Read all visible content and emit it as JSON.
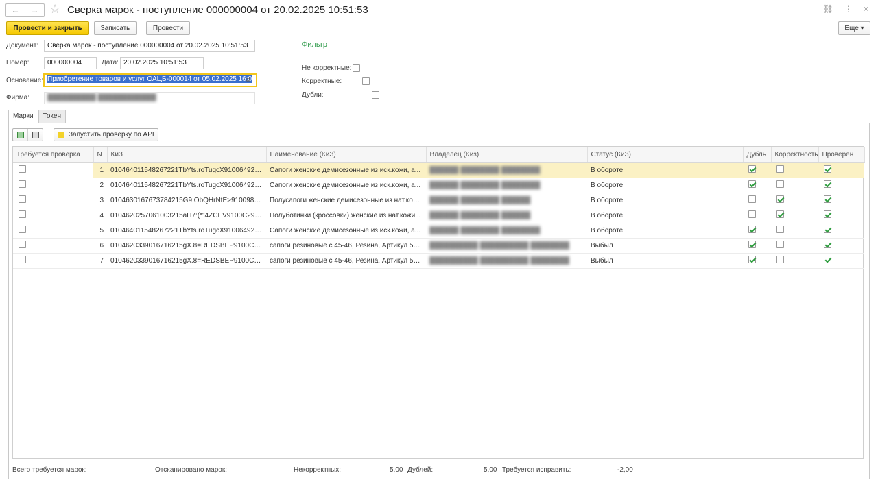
{
  "window": {
    "title": "Сверка марок - поступление 000000004 от 20.02.2025 10:51:53",
    "nav_back": "←",
    "nav_forward": "→",
    "link_icon": "⛓",
    "more_icon": "⋮",
    "close_icon": "×"
  },
  "toolbar": {
    "post_close": "Провести и закрыть",
    "save": "Записать",
    "post": "Провести",
    "more": "Еще ▾"
  },
  "form": {
    "doc_label": "Документ:",
    "doc_value": "Сверка марок - поступление 000000004 от 20.02.2025 10:51:53",
    "num_label": "Номер:",
    "num_value": "000000004",
    "date_label": "Дата:",
    "date_value": "20.02.2025 10:51:53",
    "basis_label": "Основание:",
    "basis_value": "Приобретение товаров и услуг ОАЦБ-000014 от 05.02.2025 16:0",
    "firm_label": "Фирма:",
    "firm_value": "██████████ ████████████"
  },
  "filter": {
    "title": "Фильтр",
    "incorrect": "Не корректные:",
    "correct": "Корректные:",
    "dupes": "Дубли:"
  },
  "tabs": [
    {
      "label": "Марки"
    },
    {
      "label": "Токен"
    }
  ],
  "panel": {
    "api_button": "Запустить проверку по API"
  },
  "table": {
    "headers": {
      "check": "Требуется проверка",
      "n": "N",
      "kiz": "КиЗ",
      "name": "Наименование (КиЗ)",
      "owner": "Владелец (Киз)",
      "status": "Статус (КиЗ)",
      "dupe": "Дубль",
      "correct": "Корректность",
      "verified": "Проверен"
    },
    "rows": [
      {
        "n": "1",
        "kiz": "010464011548267221TbYts.roTugcX91006492fY...",
        "name": "Сапоги женские демисезонные из иск.кожи, а...",
        "owner": "██████ ████████ ████████",
        "status": "В обороте",
        "dupe": true,
        "correct": false,
        "verified": true
      },
      {
        "n": "2",
        "kiz": "010464011548267221TbYts.roTugcX91006492fY...",
        "name": "Сапоги женские демисезонные из иск.кожи, а...",
        "owner": "██████ ████████ ████████",
        "status": "В обороте",
        "dupe": true,
        "correct": false,
        "verified": true
      },
      {
        "n": "3",
        "kiz": "0104630167673784215G9;ObQHrNtE>91009892...",
        "name": "Полусапоги женские демисезонные из нат.кож...",
        "owner": "██████ ████████ ██████",
        "status": "В обороте",
        "dupe": false,
        "correct": true,
        "verified": true
      },
      {
        "n": "4",
        "kiz": "0104620257061003215aH7:(*\"4ZCEV9100C292Z...",
        "name": "Полуботинки (кроссовки) женские из нат.кожи...",
        "owner": "██████ ████████ ██████",
        "status": "В обороте",
        "dupe": false,
        "correct": true,
        "verified": true
      },
      {
        "n": "5",
        "kiz": "010464011548267221TbYts.roTugcX91006492fY...",
        "name": "Сапоги женские демисезонные из иск.кожи, а...",
        "owner": "██████ ████████ ████████",
        "status": "В обороте",
        "dupe": true,
        "correct": false,
        "verified": true
      },
      {
        "n": "6",
        "kiz": "0104620339016716215gX.8=REDSBEP9100C29...",
        "name": "сапоги резиновые с 45-46, Резина, Артикул 56...",
        "owner": "██████████ ██████████ ████████",
        "status": "Выбыл",
        "dupe": true,
        "correct": false,
        "verified": true
      },
      {
        "n": "7",
        "kiz": "0104620339016716215gX.8=REDSBEP9100C29...",
        "name": "сапоги резиновые с 45-46, Резина, Артикул 56...",
        "owner": "██████████ ██████████ ████████",
        "status": "Выбыл",
        "dupe": true,
        "correct": false,
        "verified": true
      }
    ]
  },
  "footer": {
    "total_required": "Всего требуется марок:",
    "scanned": "Отсканировано марок:",
    "incorrect": "Некорректных:",
    "incorrect_value": "5,00",
    "dupes": "Дублей:",
    "dupes_value": "5,00",
    "to_fix": "Требуется исправить:",
    "to_fix_value": "-2,00"
  }
}
